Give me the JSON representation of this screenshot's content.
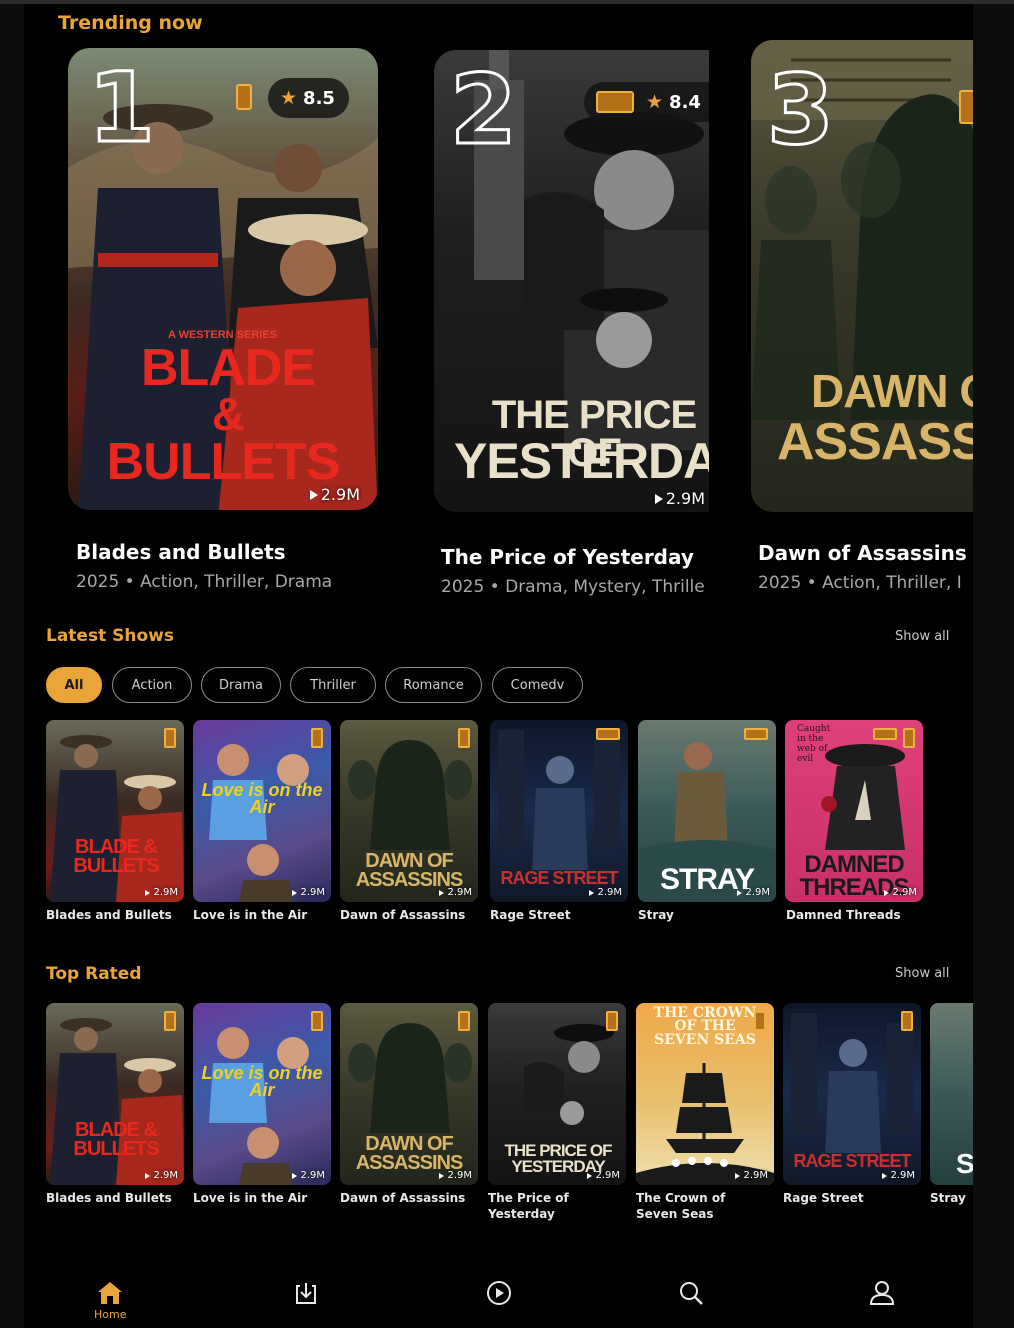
{
  "trending": {
    "title": "Trending now",
    "items": [
      {
        "rank": "1",
        "rating": "8.5",
        "views": "2.9M",
        "poster_text": [
          "BLADE",
          "&",
          "BULLETS"
        ],
        "poster_tagline": "A WESTERN SERIES",
        "name": "Blades and Bullets",
        "meta": "2025 • Action, Thriller, Drama"
      },
      {
        "rank": "2",
        "rating": "8.4",
        "views": "2.9M",
        "poster_text": [
          "THE PRICE OF",
          "YESTERDAY"
        ],
        "name": "The Price of Yesterday",
        "meta": "2025 • Drama, Mystery, Thrille"
      },
      {
        "rank": "3",
        "poster_text": [
          "DAWN OF",
          "ASSASSI"
        ],
        "name": "Dawn of Assassins",
        "meta": "2025 • Action, Thriller, I"
      }
    ]
  },
  "latest": {
    "title": "Latest Shows",
    "show_all": "Show all",
    "chips": [
      "All",
      "Action",
      "Drama",
      "Thriller",
      "Romance",
      "Comedv"
    ],
    "active_chip": "All",
    "items": [
      {
        "name": "Blades and Bullets",
        "views": "2.9M",
        "poster_text": "BLADE & BULLETS"
      },
      {
        "name": "Love is in the Air",
        "views": "2.9M",
        "poster_text": "Love is on the Air"
      },
      {
        "name": "Dawn of Assassins",
        "views": "2.9M",
        "poster_text": "DAWN OF ASSASSINS"
      },
      {
        "name": "Rage Street",
        "views": "2.9M",
        "poster_text": "RAGE STREET"
      },
      {
        "name": "Stray",
        "views": "2.9M",
        "poster_text": "STRAY"
      },
      {
        "name": "Damned Threads",
        "views": "2.9M",
        "poster_text": "DAMNED THREADS",
        "poster_tagline": "Caught in the web of evil"
      }
    ]
  },
  "top_rated": {
    "title": "Top Rated",
    "show_all": "Show all",
    "items": [
      {
        "name": "Blades and Bullets",
        "views": "2.9M",
        "poster_text": "BLADE & BULLETS"
      },
      {
        "name": "Love is in the Air",
        "views": "2.9M",
        "poster_text": "Love is on the Air"
      },
      {
        "name": "Dawn of Assassins",
        "views": "2.9M",
        "poster_text": "DAWN OF ASSASSINS"
      },
      {
        "name": "The Price of Yesterday",
        "views": "2.9M",
        "poster_text": "THE PRICE OF YESTERDAY"
      },
      {
        "name": "The Crown of Seven Seas",
        "views": "2.9M",
        "poster_text": "THE CROWN OF THE SEVEN SEAS"
      },
      {
        "name": "Rage Street",
        "views": "2.9M",
        "poster_text": "RAGE STREET"
      },
      {
        "name": "Stray",
        "views": "",
        "poster_text": "S"
      }
    ]
  },
  "nav": {
    "home": "Home",
    "icons": [
      "home-icon",
      "download-icon",
      "play-icon",
      "search-icon",
      "profile-icon"
    ],
    "active": "Home"
  },
  "colors": {
    "accent": "#e9a53a",
    "background": "#000000",
    "text_muted": "#a8a8a8"
  }
}
